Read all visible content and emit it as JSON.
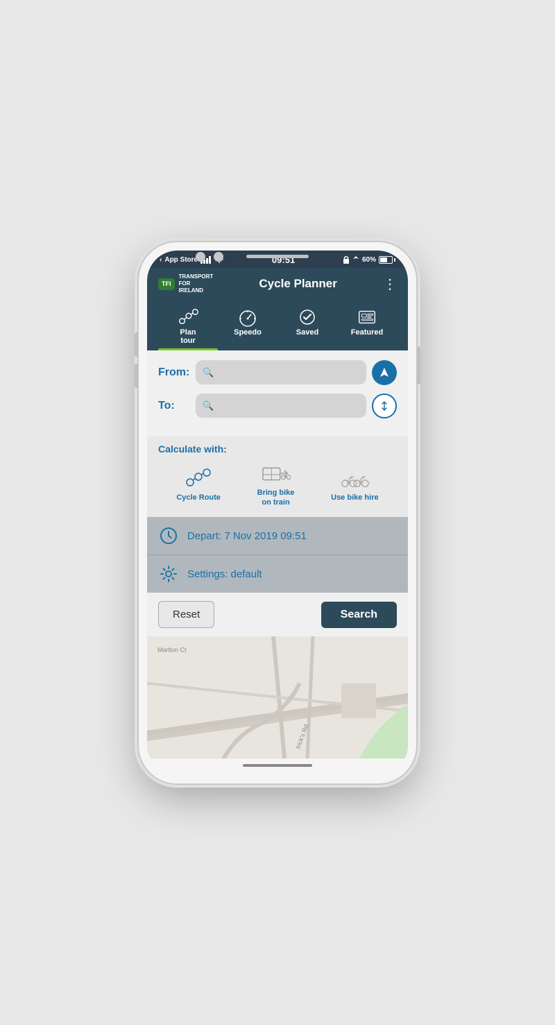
{
  "device": {
    "time": "09:51",
    "carrier": "App Store",
    "signal_bars": 4,
    "battery_percent": "60%"
  },
  "app": {
    "title": "Cycle Planner",
    "logo_text": "TFI",
    "logo_subtext": "TRANSPORT\nFOR\nIRELAND",
    "menu_icon": "⋮"
  },
  "nav": {
    "tabs": [
      {
        "id": "plan-tour",
        "label": "Plan\ntour",
        "active": true
      },
      {
        "id": "speedo",
        "label": "Speedo",
        "active": false
      },
      {
        "id": "saved",
        "label": "Saved",
        "active": false
      },
      {
        "id": "featured",
        "label": "Featured",
        "active": false
      }
    ]
  },
  "form": {
    "from_label": "From:",
    "from_placeholder": "",
    "to_label": "To:",
    "to_placeholder": ""
  },
  "calculate": {
    "label": "Calculate with:",
    "options": [
      {
        "id": "cycle-route",
        "label": "Cycle Route"
      },
      {
        "id": "bring-bike",
        "label": "Bring bike\non train"
      },
      {
        "id": "bike-hire",
        "label": "Use bike hire"
      }
    ]
  },
  "info": {
    "depart_label": "Depart: 7 Nov 2019 09:51",
    "settings_label": "Settings: default"
  },
  "actions": {
    "reset_label": "Reset",
    "search_label": "Search"
  },
  "map": {
    "street_label": "Marlton Ct"
  }
}
